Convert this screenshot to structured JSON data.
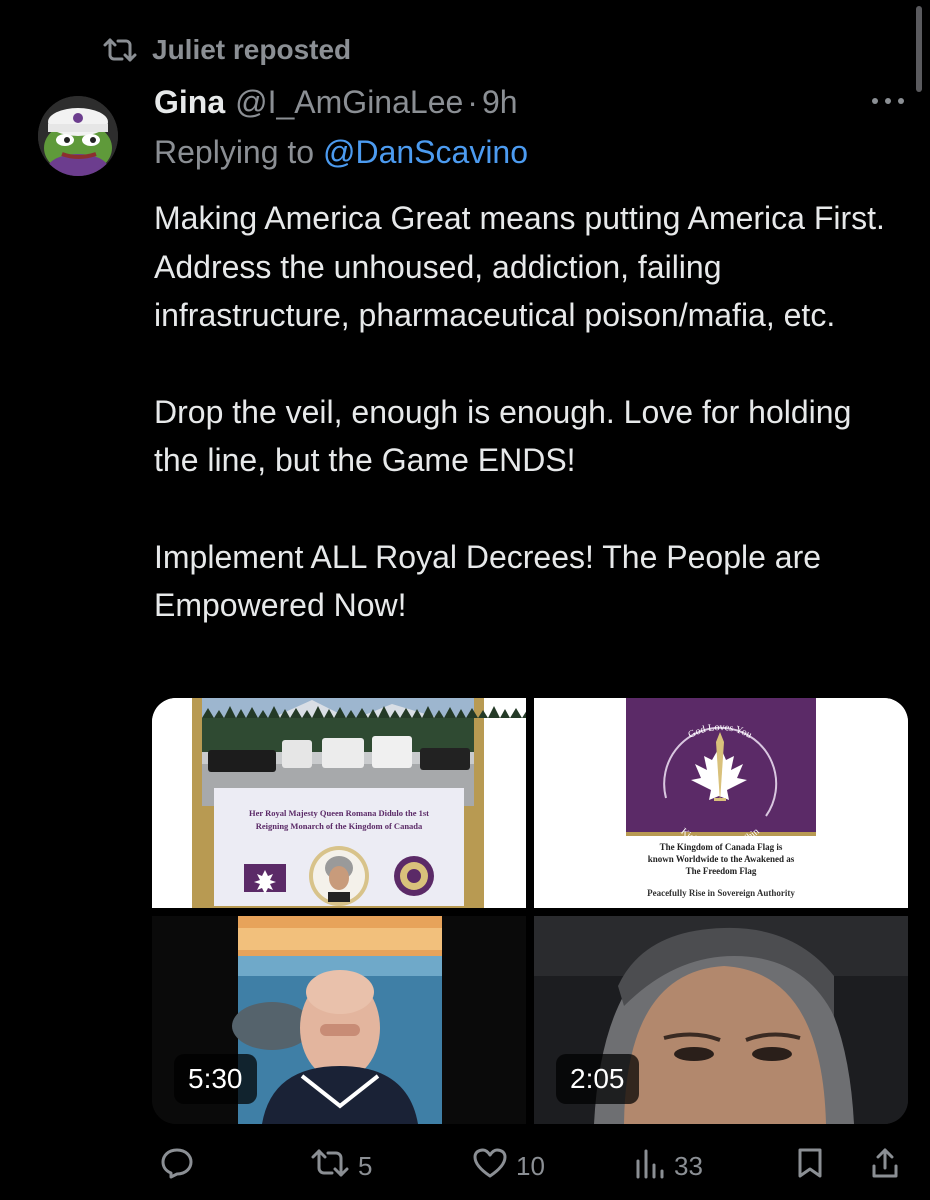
{
  "repost": {
    "label": "Juliet reposted",
    "icon": "repost-icon"
  },
  "tweet": {
    "display_name": "Gina",
    "handle": "@I_AmGinaLee",
    "separator": "·",
    "time": "9h",
    "reply_prefix": "Replying to",
    "reply_to": "@DanScavino",
    "paragraphs": [
      "Making America Great means putting America First. Address the unhoused, addiction, failing infrastructure, pharmaceutical poison/mafia, etc.",
      "Drop the veil, enough is enough. Love for holding the line, but the Game ENDS!",
      "Implement ALL Royal Decrees! The People are Empowered Now!"
    ]
  },
  "media": {
    "image1": {
      "caption_line1": "Her Royal Majesty Queen Romana Didulo the 1st",
      "caption_line2": "Reigning Monarch of the Kingdom of Canada"
    },
    "image2": {
      "arc_top": "God Loves You",
      "arc_bottom": "Kiçi Manitō Osākihin",
      "caption_line1": "The Kingdom of Canada Flag is",
      "caption_line2": "known Worldwide to the Awakened as",
      "caption_line3": "The Freedom Flag",
      "tagline": "Peacefully Rise in Sovereign Authority"
    },
    "video1": {
      "duration": "5:30"
    },
    "video2": {
      "duration": "2:05"
    }
  },
  "actions": {
    "reply": {
      "icon": "reply-icon",
      "count": ""
    },
    "repost": {
      "icon": "repost-icon",
      "count": "5"
    },
    "like": {
      "icon": "heart-icon",
      "count": "10"
    },
    "views": {
      "icon": "views-icon",
      "count": "33"
    },
    "bookmark": {
      "icon": "bookmark-icon"
    },
    "share": {
      "icon": "share-icon"
    }
  },
  "colors": {
    "background": "#000000",
    "text": "#e7e9ea",
    "muted": "#8b8f94",
    "link": "#4c9bf0",
    "flag_purple": "#5b2a67",
    "gold": "#b89a52"
  }
}
